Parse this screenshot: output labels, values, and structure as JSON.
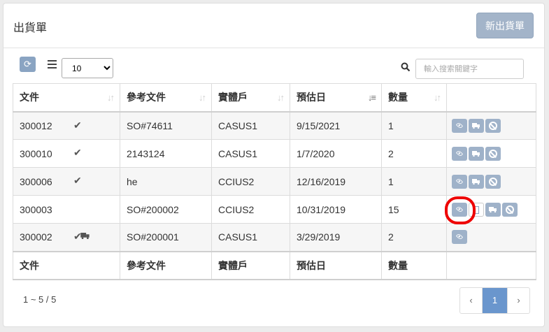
{
  "header": {
    "title": "出貨單",
    "new_button": "新出貨單"
  },
  "toolbar": {
    "page_size": "10",
    "page_size_options": [
      "10"
    ],
    "search_placeholder": "輸入搜索關鍵字"
  },
  "table": {
    "columns": [
      "文件",
      "參考文件",
      "實體戶",
      "預估日",
      "數量",
      ""
    ],
    "rows": [
      {
        "doc": "300012",
        "ref": "SO#74611",
        "entity": "CASUS1",
        "date": "9/15/2021",
        "qty": "1"
      },
      {
        "doc": "300010",
        "ref": "2143124",
        "entity": "CASUS1",
        "date": "1/7/2020",
        "qty": "2"
      },
      {
        "doc": "300006",
        "ref": "he",
        "entity": "CCIUS2",
        "date": "12/16/2019",
        "qty": "1"
      },
      {
        "doc": "300003",
        "ref": "SO#200002",
        "entity": "CCIUS2",
        "date": "10/31/2019",
        "qty": "15"
      },
      {
        "doc": "300002",
        "ref": "SO#200001",
        "entity": "CASUS1",
        "date": "3/29/2019",
        "qty": "2"
      }
    ]
  },
  "footer": {
    "range": "1 ~ 5 / 5"
  },
  "pager": {
    "prev": "‹",
    "current": "1",
    "next": "›"
  },
  "icons": {
    "refresh": "refresh-icon",
    "list": "list-icon",
    "search": "search-icon",
    "view": "eye-icon",
    "ship": "truck-icon",
    "cancel": "ban-icon",
    "file": "file-icon",
    "done": "check-icon"
  },
  "colors": {
    "action_button": "#9fb2c9",
    "primary_page": "#6a96cd",
    "highlight": "#e00000"
  }
}
